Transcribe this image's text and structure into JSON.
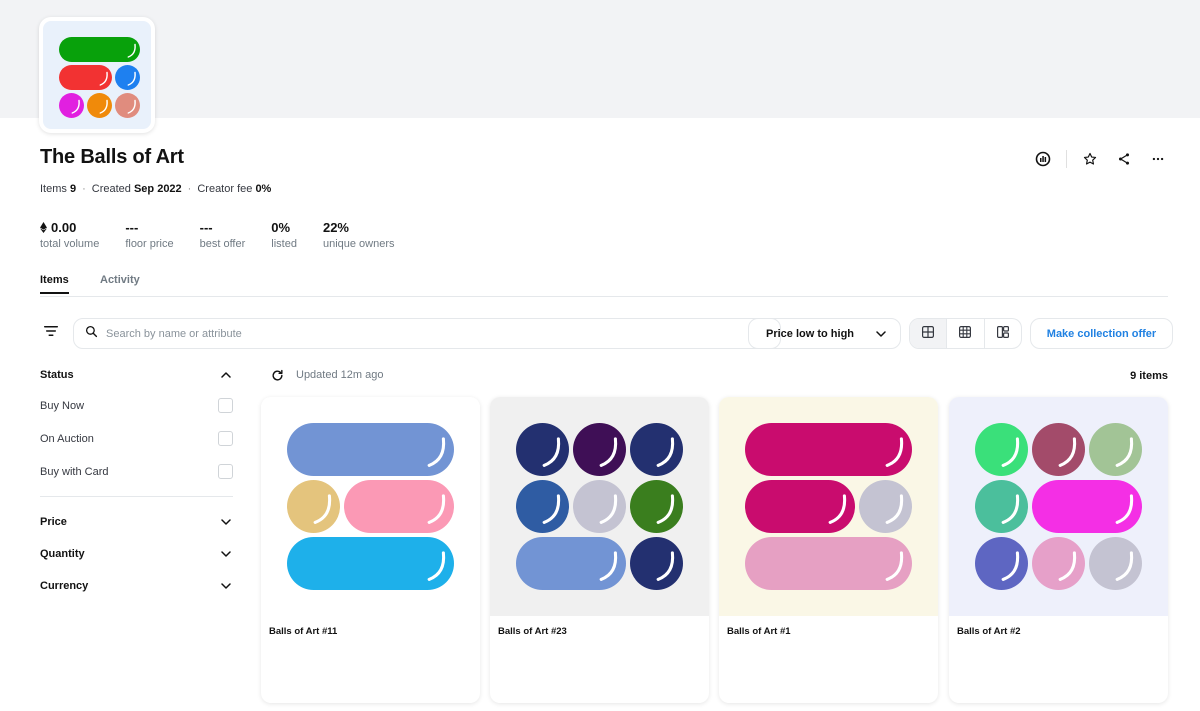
{
  "collection": {
    "title": "The Balls of Art",
    "meta": {
      "items_label": "Items",
      "items_value": "9",
      "created_label": "Created",
      "created_value": "Sep 2022",
      "fee_label": "Creator fee",
      "fee_value": "0%"
    },
    "stats": [
      {
        "value": "0.00",
        "label": "total volume",
        "icon": "ethereum-icon"
      },
      {
        "value": "---",
        "label": "floor price"
      },
      {
        "value": "---",
        "label": "best offer"
      },
      {
        "value": "0%",
        "label": "listed"
      },
      {
        "value": "22%",
        "label": "unique owners"
      }
    ],
    "header_actions": [
      "activity-chart-icon",
      "star-icon",
      "share-icon",
      "more-icon"
    ]
  },
  "tabs": [
    {
      "label": "Items",
      "active": true
    },
    {
      "label": "Activity",
      "active": false
    }
  ],
  "toolbar": {
    "search_placeholder": "Search by name or attribute",
    "sort_label": "Price low to high",
    "view_modes": [
      "large-grid-icon",
      "small-grid-icon",
      "mosaic-icon"
    ],
    "offer_label": "Make collection offer"
  },
  "sidebar": {
    "status": {
      "title": "Status",
      "options": [
        "Buy Now",
        "On Auction",
        "Buy with Card"
      ]
    },
    "sections": [
      "Price",
      "Quantity",
      "Currency"
    ]
  },
  "results": {
    "updated": "Updated 12m ago",
    "count": "9 items"
  },
  "colors": {
    "accent": "#2081e2",
    "banner": "#f2f3f5"
  },
  "items": [
    {
      "name": "Balls of Art #11",
      "background": "#ffffff",
      "rows": [
        [
          {
            "color": "#7294d4",
            "span": 3
          }
        ],
        [
          {
            "color": "#e4c47d",
            "span": 1
          },
          {
            "color": "#fb99b5",
            "span": 2
          }
        ],
        [
          {
            "color": "#1eb0ea",
            "span": 3
          }
        ]
      ]
    },
    {
      "name": "Balls of Art #23",
      "background": "#f0f0f0",
      "rows": [
        [
          {
            "color": "#233070",
            "span": 1
          },
          {
            "color": "#3f0f56",
            "span": 1
          },
          {
            "color": "#233070",
            "span": 1
          }
        ],
        [
          {
            "color": "#2f5ca3",
            "span": 1
          },
          {
            "color": "#c4c3d2",
            "span": 1
          },
          {
            "color": "#3a7e1e",
            "span": 1
          }
        ],
        [
          {
            "color": "#7294d4",
            "span": 2
          },
          {
            "color": "#233070",
            "span": 1
          }
        ]
      ]
    },
    {
      "name": "Balls of Art #1",
      "background": "#faf7e6",
      "rows": [
        [
          {
            "color": "#c90c6e",
            "span": 3
          }
        ],
        [
          {
            "color": "#c90c6e",
            "span": 2
          },
          {
            "color": "#c4c3d2",
            "span": 1
          }
        ],
        [
          {
            "color": "#e6a0c3",
            "span": 3
          }
        ]
      ]
    },
    {
      "name": "Balls of Art #2",
      "background": "#eef0fb",
      "rows": [
        [
          {
            "color": "#3ae07a",
            "span": 1
          },
          {
            "color": "#a34b6a",
            "span": 1
          },
          {
            "color": "#a2c496",
            "span": 1
          }
        ],
        [
          {
            "color": "#4bbf9c",
            "span": 1
          },
          {
            "color": "#f42fe5",
            "span": 2
          }
        ],
        [
          {
            "color": "#5e66c2",
            "span": 1
          },
          {
            "color": "#e6a0c9",
            "span": 1
          },
          {
            "color": "#c4c3d2",
            "span": 1
          }
        ]
      ]
    }
  ],
  "logo": {
    "rows": [
      [
        {
          "color": "#08a10b",
          "span": 3
        }
      ],
      [
        {
          "color": "#f23232",
          "span": 2
        },
        {
          "color": "#1e80f0",
          "span": 1
        }
      ],
      [
        {
          "color": "#e120e0",
          "span": 1
        },
        {
          "color": "#f08a0a",
          "span": 1
        },
        {
          "color": "#e08c7e",
          "span": 1
        }
      ]
    ]
  }
}
